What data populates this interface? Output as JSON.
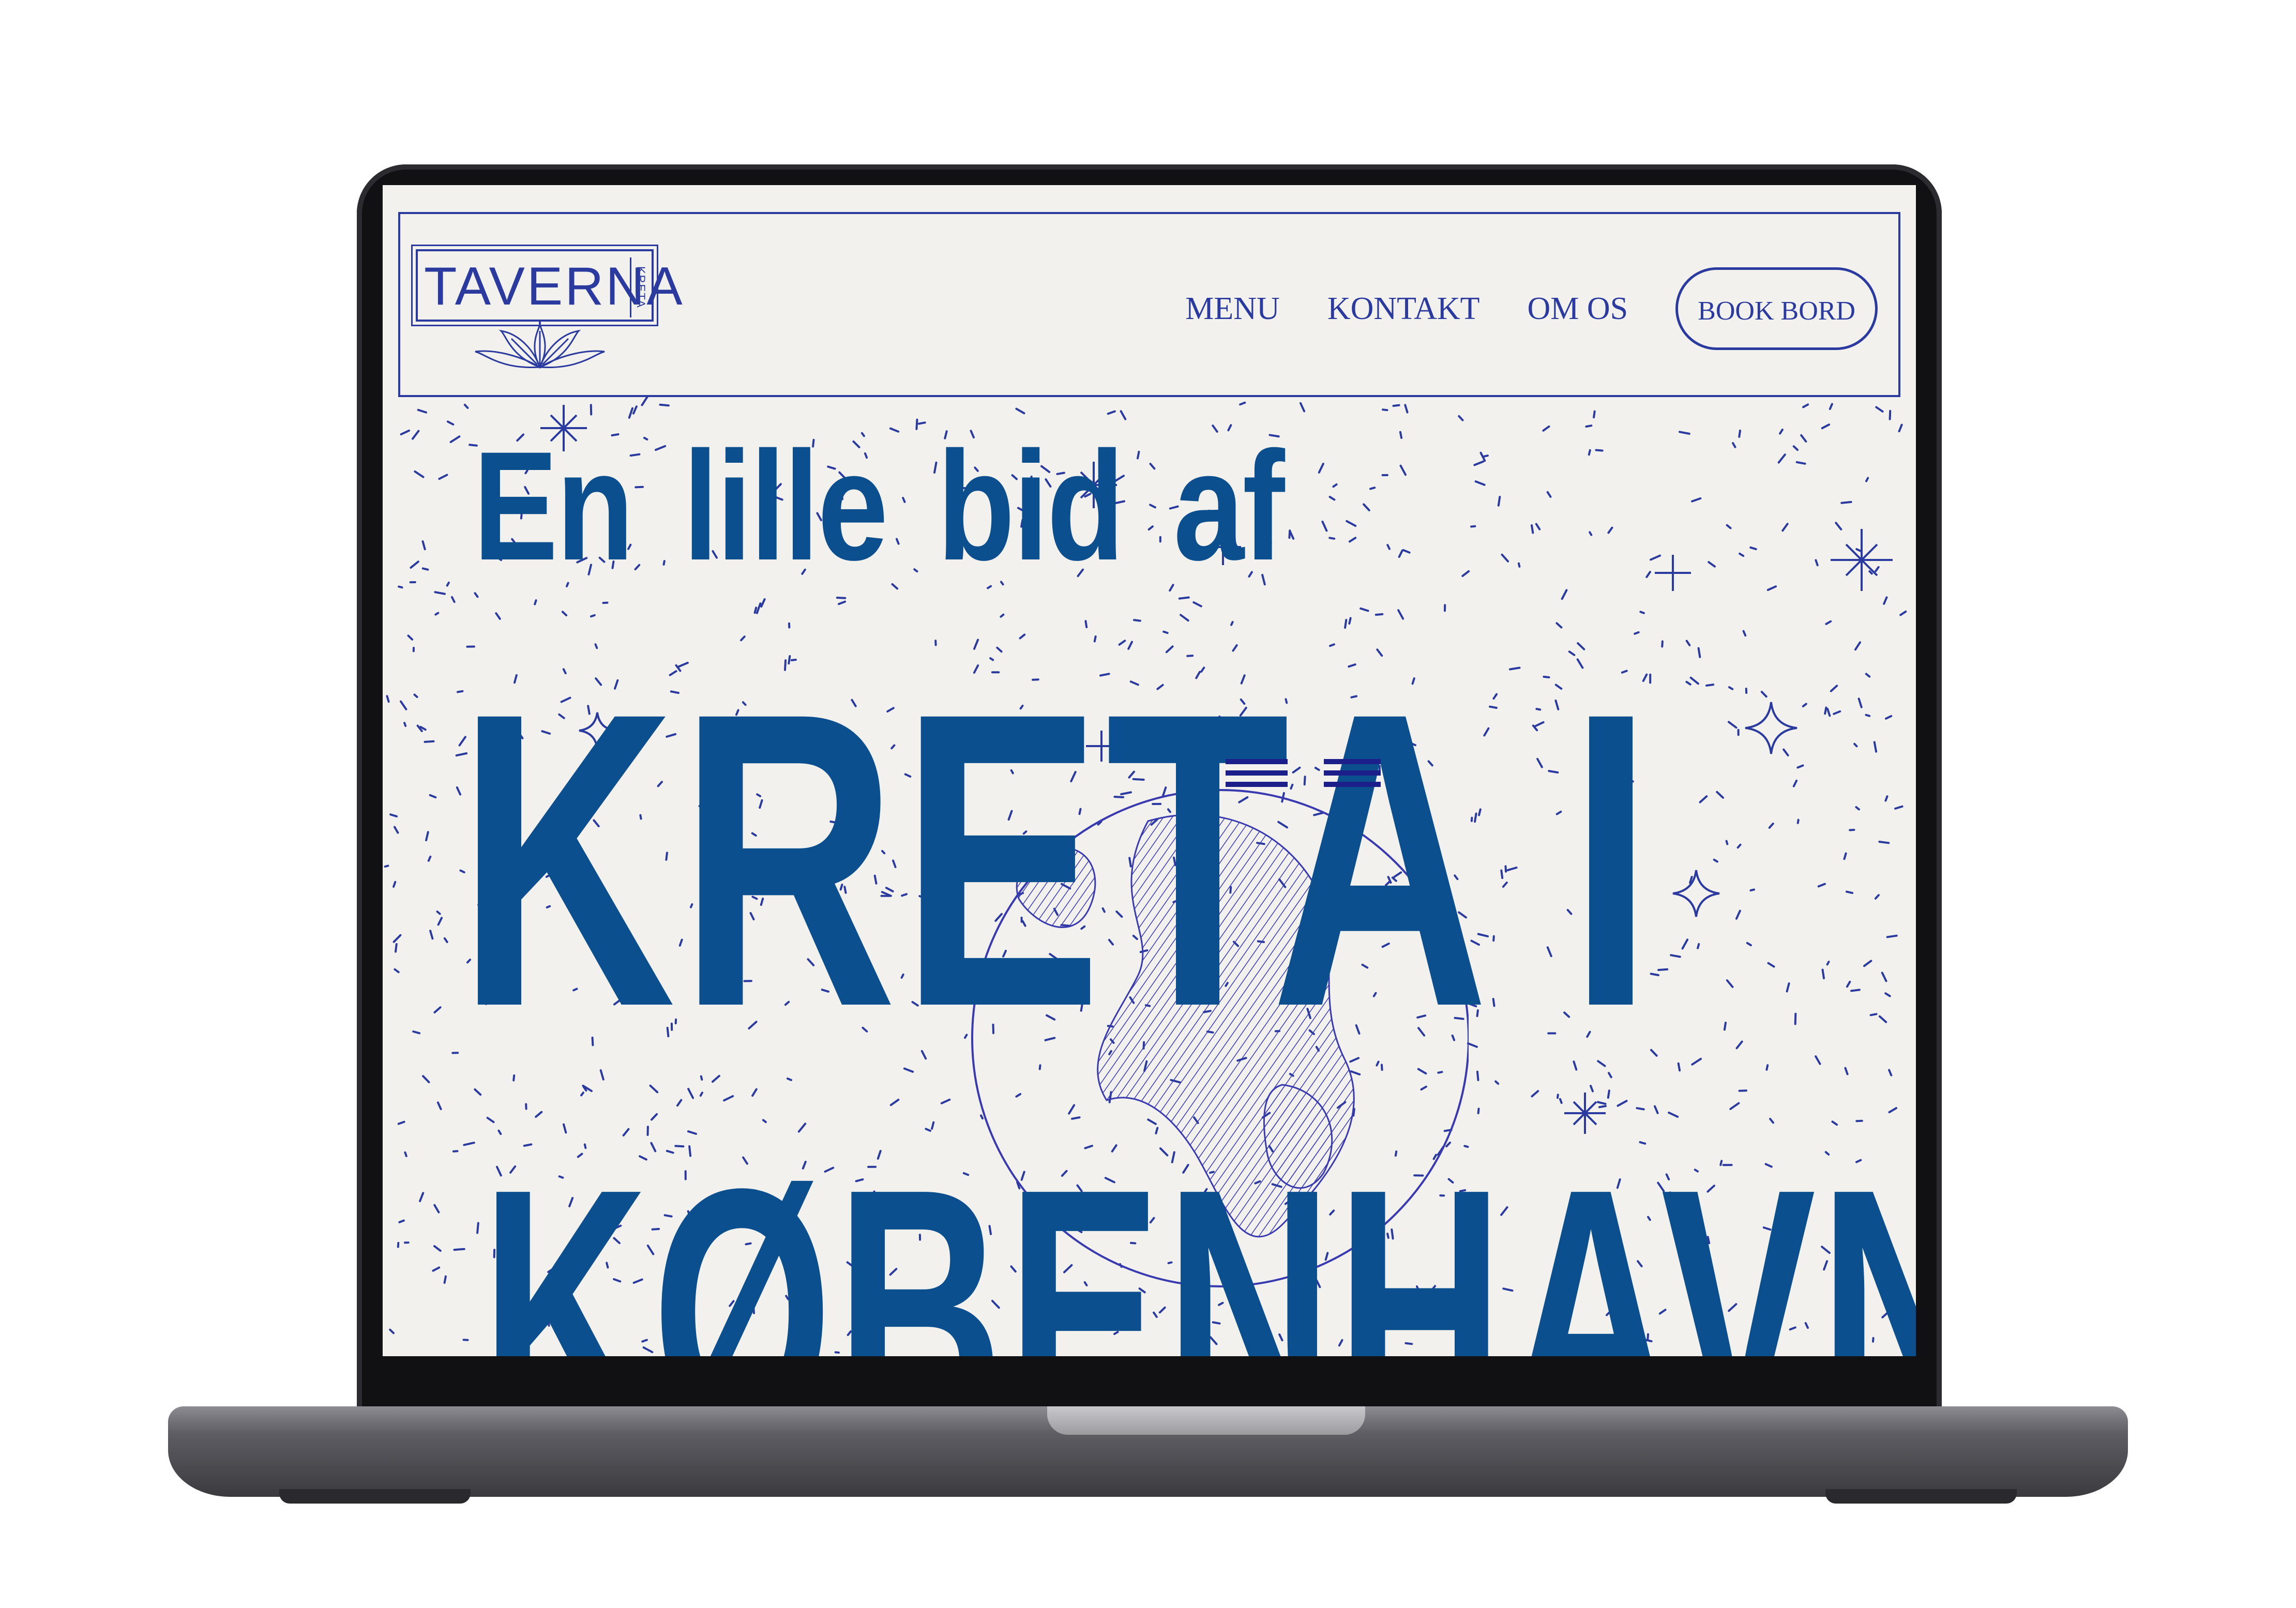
{
  "site": {
    "logo": {
      "wordmark": "TAVERNA",
      "subtitle": "KRETA"
    },
    "nav": {
      "links": [
        "MENU",
        "KONTAKT",
        "OM OS"
      ],
      "cta": "BOOK BORD"
    },
    "hero": {
      "line1": "En lille bid af",
      "line2": "KRETA I",
      "line3": "KØBENHAVN"
    }
  },
  "colors": {
    "brand_blue": "#0b4f8e",
    "line_blue": "#2a3a9e",
    "background": "#f2f1ee"
  },
  "icons": [
    "leaf-ornament-icon",
    "star-sparkle-icon",
    "globe-illustration",
    "greek-flag-icon"
  ]
}
